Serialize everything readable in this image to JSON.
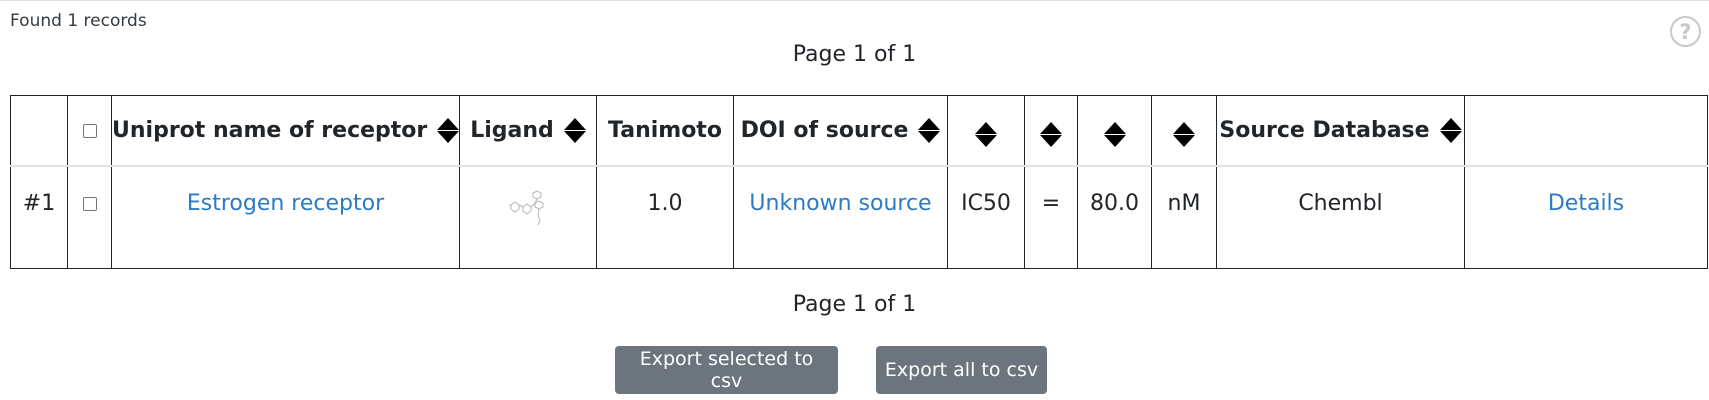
{
  "header": {
    "found_text": "Found 1 records",
    "help_icon": "?"
  },
  "pagination": {
    "top_text": "Page 1 of 1",
    "bottom_text": "Page 1 of 1"
  },
  "table": {
    "columns": [
      {
        "label": "",
        "sortable": false
      },
      {
        "label": "",
        "sortable": false,
        "checkbox": true
      },
      {
        "label": "Uniprot name of receptor",
        "sortable": true
      },
      {
        "label": "Ligand",
        "sortable": true
      },
      {
        "label": "Tanimoto",
        "sortable": false
      },
      {
        "label": "DOI of source",
        "sortable": true
      },
      {
        "label": "",
        "sortable": true
      },
      {
        "label": "",
        "sortable": true
      },
      {
        "label": "",
        "sortable": true
      },
      {
        "label": "",
        "sortable": true
      },
      {
        "label": "Source Database",
        "sortable": true
      },
      {
        "label": "",
        "sortable": false
      }
    ],
    "rows": [
      {
        "index": "#1",
        "checked": false,
        "receptor": "Estrogen receptor",
        "ligand_icon": "molecule-structure-icon",
        "tanimoto": "1.0",
        "doi": "Unknown source",
        "activity_type": "IC50",
        "relation": "=",
        "value": "80.0",
        "unit": "nM",
        "source_database": "Chembl",
        "details": "Details"
      }
    ]
  },
  "actions": {
    "export_selected": "Export selected to csv",
    "export_all": "Export all to csv"
  },
  "colors": {
    "link": "#2a7bc4",
    "button_bg": "#6c757d",
    "button_text": "#ffffff",
    "border": "#212529"
  }
}
